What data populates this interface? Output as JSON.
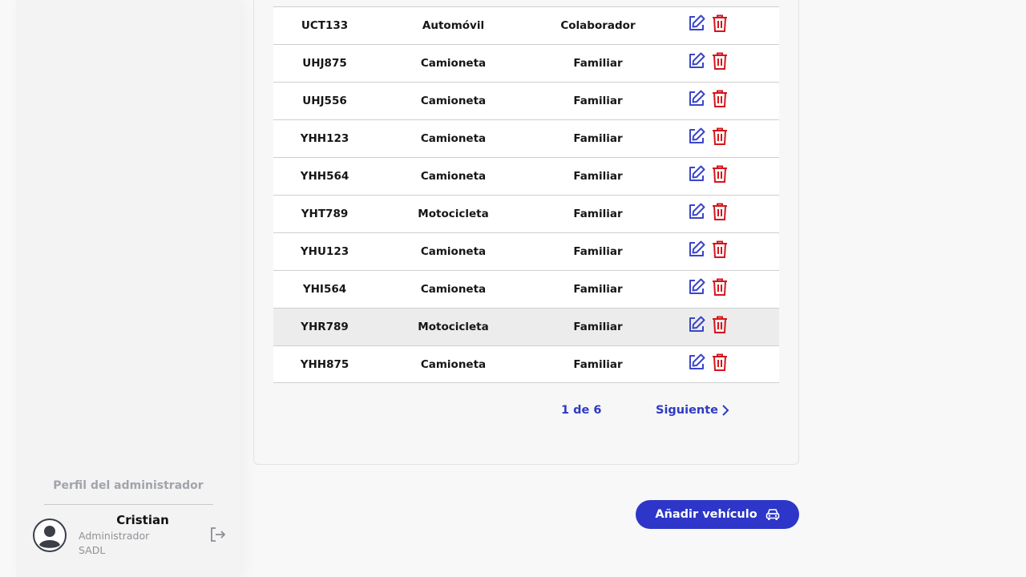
{
  "sidebar": {
    "profile_heading": "Perfil del administrador",
    "user": {
      "name": "Cristian",
      "role": "Administrador",
      "org": "SADL"
    },
    "icons": {
      "avatar": "user-circle-icon",
      "logout": "logout-icon"
    }
  },
  "table": {
    "rows": [
      {
        "plate": "UCT133",
        "type": "Automóvil",
        "category": "Colaborador"
      },
      {
        "plate": "UHJ875",
        "type": "Camioneta",
        "category": "Familiar"
      },
      {
        "plate": "UHJ556",
        "type": "Camioneta",
        "category": "Familiar"
      },
      {
        "plate": "YHH123",
        "type": "Camioneta",
        "category": "Familiar"
      },
      {
        "plate": "YHH564",
        "type": "Camioneta",
        "category": "Familiar"
      },
      {
        "plate": "YHT789",
        "type": "Motocicleta",
        "category": "Familiar"
      },
      {
        "plate": "YHU123",
        "type": "Camioneta",
        "category": "Familiar"
      },
      {
        "plate": "YHI564",
        "type": "Camioneta",
        "category": "Familiar"
      },
      {
        "plate": "YHR789",
        "type": "Motocicleta",
        "category": "Familiar",
        "highlighted": true
      },
      {
        "plate": "YHH875",
        "type": "Camioneta",
        "category": "Familiar"
      }
    ],
    "row_icons": {
      "edit": "edit-icon",
      "delete": "trash-icon"
    }
  },
  "pagination": {
    "count": "1 de 6",
    "next_label": "Siguiente",
    "next_icon": "chevron-right-icon"
  },
  "actions": {
    "add_vehicle_label": "Añadir vehículo",
    "add_vehicle_icon": "car-icon"
  },
  "colors": {
    "accent": "#2d36c8",
    "link": "#2d3bc2",
    "edit_icon": "#3b46c7",
    "delete_icon": "#d4161d",
    "muted_text": "#8f9196"
  }
}
